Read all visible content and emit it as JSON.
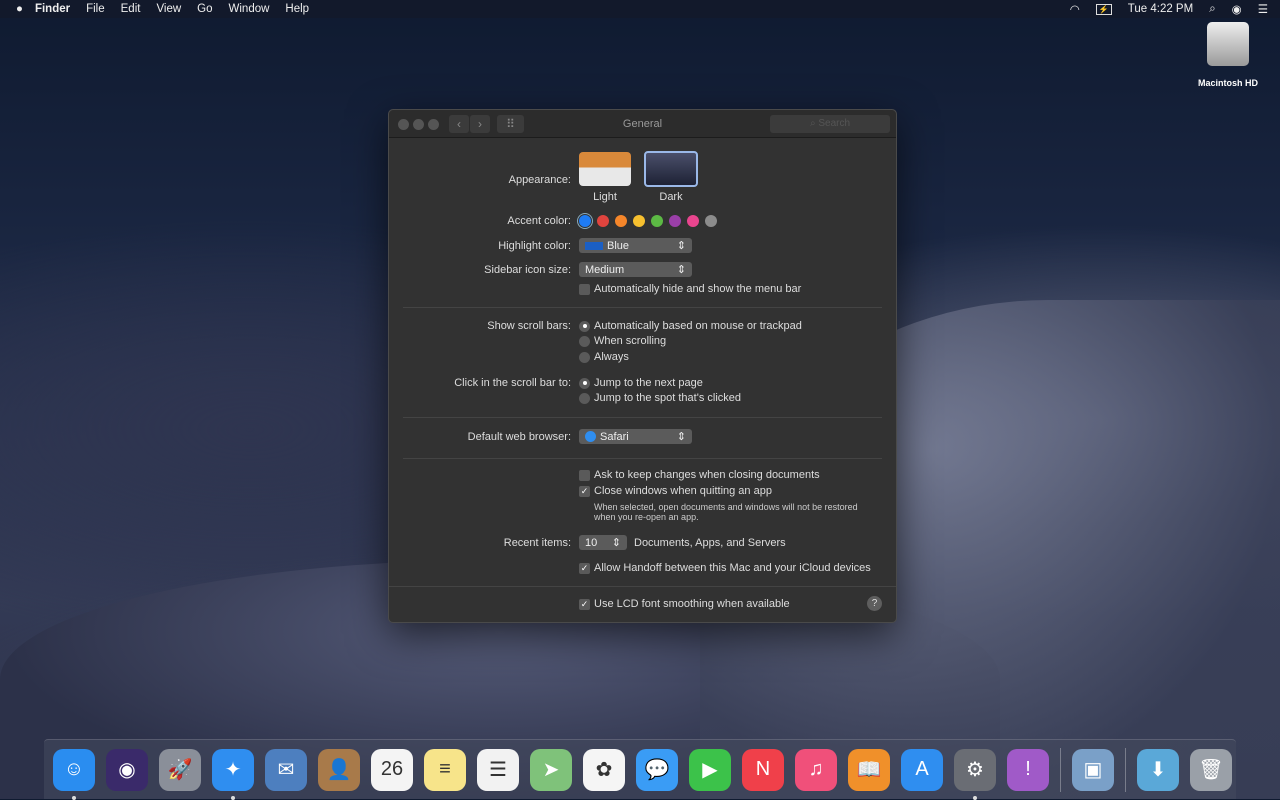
{
  "menubar": {
    "app": "Finder",
    "items": [
      "File",
      "Edit",
      "View",
      "Go",
      "Window",
      "Help"
    ],
    "clock": "Tue 4:22 PM"
  },
  "desktop": {
    "drive_label": "Macintosh HD"
  },
  "window": {
    "title": "General",
    "search_placeholder": "Search",
    "appearance": {
      "label": "Appearance:",
      "options": [
        "Light",
        "Dark"
      ],
      "selected": "Dark"
    },
    "accent": {
      "label": "Accent color:",
      "colors": [
        "#1e7cf5",
        "#e0443e",
        "#f5862a",
        "#f7c02f",
        "#5cb944",
        "#9a3fa8",
        "#e9458e",
        "#8c8c8c"
      ],
      "selected": "#1e7cf5"
    },
    "highlight": {
      "label": "Highlight color:",
      "value": "Blue",
      "swatch": "#1b5fc4"
    },
    "sidebar": {
      "label": "Sidebar icon size:",
      "value": "Medium"
    },
    "auto_hide": {
      "label": "Automatically hide and show the menu bar",
      "checked": false
    },
    "scroll": {
      "label": "Show scroll bars:",
      "options": [
        "Automatically based on mouse or trackpad",
        "When scrolling",
        "Always"
      ],
      "selected": 0
    },
    "click": {
      "label": "Click in the scroll bar to:",
      "options": [
        "Jump to the next page",
        "Jump to the spot that's clicked"
      ],
      "selected": 0
    },
    "browser": {
      "label": "Default web browser:",
      "value": "Safari"
    },
    "ask_keep": {
      "label": "Ask to keep changes when closing documents",
      "checked": false
    },
    "close_windows": {
      "label": "Close windows when quitting an app",
      "checked": true,
      "note1": "When selected, open documents and windows will not be restored",
      "note2": "when you re-open an app."
    },
    "recent": {
      "label": "Recent items:",
      "value": "10",
      "suffix": "Documents, Apps, and Servers"
    },
    "handoff": {
      "label": "Allow Handoff between this Mac and your iCloud devices",
      "checked": true
    },
    "lcd": {
      "label": "Use LCD font smoothing when available",
      "checked": true
    },
    "help": "?"
  },
  "dock": [
    {
      "name": "finder",
      "bg": "#2a8df0",
      "glyph": "☺",
      "running": true
    },
    {
      "name": "siri",
      "bg": "#3a2a6a",
      "glyph": "◉",
      "running": false
    },
    {
      "name": "launchpad",
      "bg": "#8a8f99",
      "glyph": "🚀",
      "running": false
    },
    {
      "name": "safari",
      "bg": "#2f8ef0",
      "glyph": "✦",
      "running": true
    },
    {
      "name": "mail",
      "bg": "#4d7fbf",
      "glyph": "✉",
      "running": false
    },
    {
      "name": "contacts",
      "bg": "#a87a4a",
      "glyph": "👤",
      "running": false
    },
    {
      "name": "calendar",
      "bg": "#f4f4f4",
      "glyph": "26",
      "running": false
    },
    {
      "name": "notes",
      "bg": "#f7e48a",
      "glyph": "≡",
      "running": false
    },
    {
      "name": "reminders",
      "bg": "#f2f2f2",
      "glyph": "☰",
      "running": false
    },
    {
      "name": "maps",
      "bg": "#7fc27a",
      "glyph": "➤",
      "running": false
    },
    {
      "name": "photos",
      "bg": "#f5f5f5",
      "glyph": "✿",
      "running": false
    },
    {
      "name": "messages",
      "bg": "#3a9cf5",
      "glyph": "💬",
      "running": false
    },
    {
      "name": "facetime",
      "bg": "#3cc24a",
      "glyph": "▶",
      "running": false
    },
    {
      "name": "news",
      "bg": "#f0404a",
      "glyph": "N",
      "running": false
    },
    {
      "name": "itunes",
      "bg": "#f0507a",
      "glyph": "♫",
      "running": false
    },
    {
      "name": "books",
      "bg": "#f0902a",
      "glyph": "📖",
      "running": false
    },
    {
      "name": "app-store",
      "bg": "#2f8ef0",
      "glyph": "A",
      "running": false
    },
    {
      "name": "system-preferences",
      "bg": "#6a6d74",
      "glyph": "⚙",
      "running": true
    },
    {
      "name": "feedback-assistant",
      "bg": "#a05ac8",
      "glyph": "!",
      "running": false
    },
    {
      "name": "preview",
      "bg": "#7aa0c8",
      "glyph": "▣",
      "running": false
    },
    {
      "name": "downloads",
      "bg": "#5aa8d8",
      "glyph": "⬇",
      "running": false
    },
    {
      "name": "trash",
      "bg": "#9aa0a8",
      "glyph": "🗑",
      "running": false
    }
  ]
}
